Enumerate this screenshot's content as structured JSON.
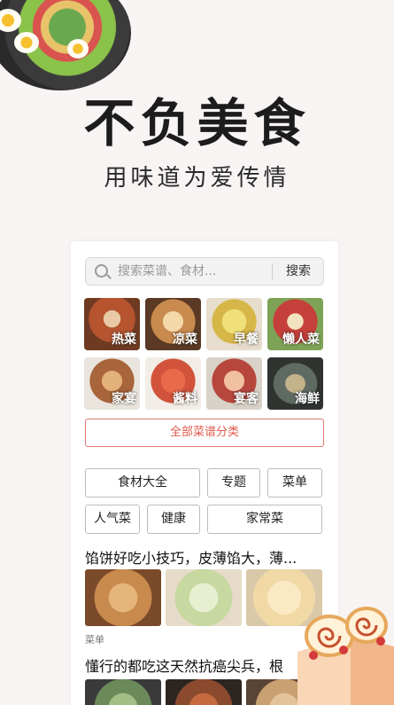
{
  "hero": {
    "title": "不负美食",
    "subtitle": "用味道为爱传情"
  },
  "search": {
    "placeholder": "搜索菜谱、食材...",
    "button_label": "搜索"
  },
  "categories": [
    {
      "label": "热菜",
      "color": "#b5542f"
    },
    {
      "label": "凉菜",
      "color": "#c98a4e"
    },
    {
      "label": "早餐",
      "color": "#d7b648"
    },
    {
      "label": "懒人菜",
      "color": "#c5403a"
    },
    {
      "label": "家宴",
      "color": "#a8643a"
    },
    {
      "label": "酱料",
      "color": "#d2533b"
    },
    {
      "label": "宴客",
      "color": "#b7463d"
    },
    {
      "label": "海鲜",
      "color": "#5f6a63"
    }
  ],
  "all_categories_label": "全部菜谱分类",
  "quick_links": {
    "row1": [
      "食材大全",
      "专题",
      "菜单"
    ],
    "row2": [
      "人气菜",
      "健康",
      "家常菜"
    ]
  },
  "articles": [
    {
      "title": "馅饼好吃小技巧，皮薄馅大，薄...",
      "tag": "菜单",
      "thumb_colors": [
        "#c98a4e",
        "#c7d8a0",
        "#f1d9a6"
      ]
    },
    {
      "title": "懂行的都吃这天然抗癌尖兵，根",
      "tag": "",
      "thumb_colors": [
        "#6b8a5a",
        "#8b4a2e",
        "#c9a071"
      ]
    }
  ],
  "colors": {
    "accent": "#e05a4c",
    "background": "#f9f4f4"
  }
}
